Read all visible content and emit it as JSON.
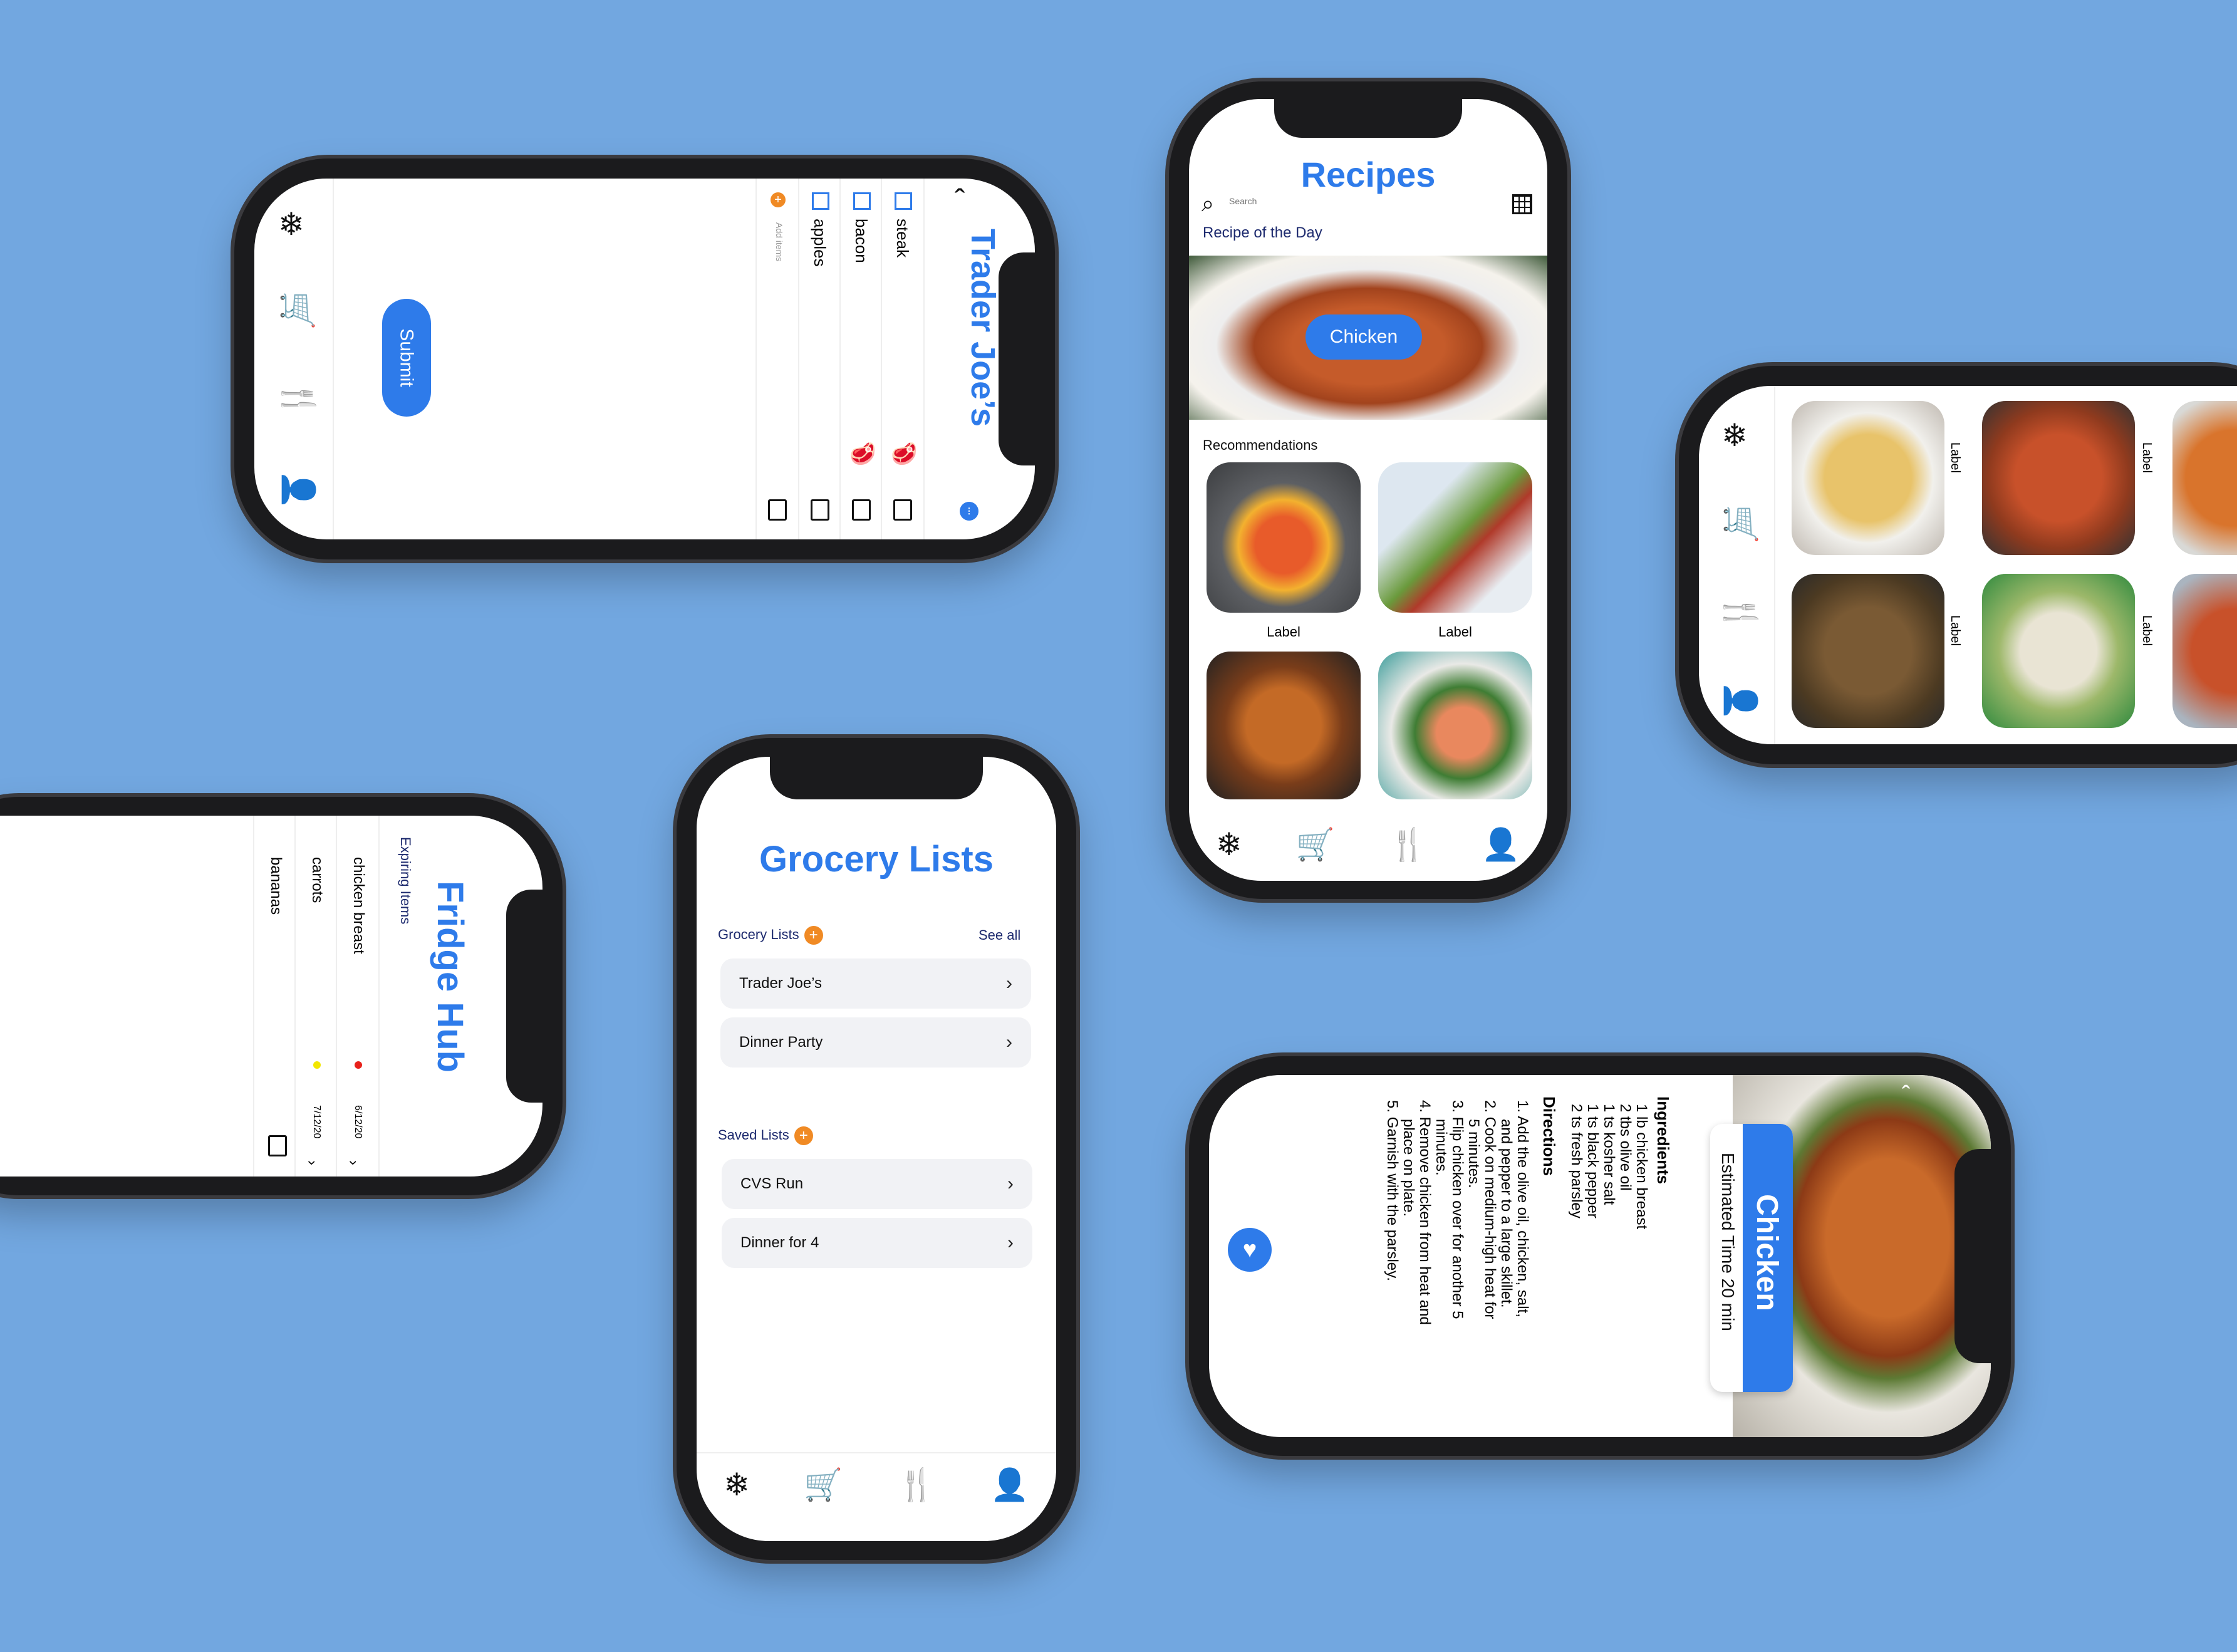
{
  "colors": {
    "background": "#72a7e0",
    "accent_blue": "#2e7bea",
    "accent_orange": "#f08a24"
  },
  "trader": {
    "title": "Trader Joe’s",
    "items": [
      "steak",
      "bacon",
      "apples"
    ],
    "add_items": "Add items",
    "submit": "Submit",
    "icons": [
      "snowflake-icon",
      "cart-icon",
      "fork-knife-icon",
      "person-icon"
    ]
  },
  "recipes": {
    "title": "Recipes",
    "search_placeholder": "Search",
    "section_day": "Recipe of the Day",
    "featured": "Chicken",
    "section_rec": "Recommendations",
    "cards": [
      "Label",
      "Label"
    ]
  },
  "gallery": {
    "labels": [
      "Label",
      "Label",
      "Label",
      "Label"
    ]
  },
  "fridge": {
    "title": "Fridge Hub",
    "section": "Expiring Items",
    "items": [
      {
        "name": "chicken breast",
        "date": "6/12/20",
        "dot": "#e8211b"
      },
      {
        "name": "carrots",
        "date": "7/12/20",
        "dot": "#f2e600"
      },
      {
        "name": "bananas",
        "date": "",
        "dot": ""
      }
    ]
  },
  "grocery": {
    "title": "Grocery Lists",
    "section_lists": "Grocery Lists",
    "see_all": "See all",
    "lists": [
      "Trader Joe’s",
      "Dinner Party"
    ],
    "section_saved": "Saved Lists",
    "saved": [
      "CVS Run",
      "Dinner for 4"
    ]
  },
  "detail": {
    "title": "Chicken",
    "time": "Estimated Time 20 min",
    "ingredients_heading": "Ingredients",
    "ingredients": [
      "1 lb chicken breast",
      "2 tbs olive oil",
      "1 ts kosher salt",
      "1 ts black pepper",
      "2 ts fresh parsley"
    ],
    "directions_heading": "Directions",
    "directions": [
      "1. Add the olive oil, chicken, salt,",
      "and pepper to a large skillet.",
      "2. Cook on medium-high heat for",
      "5 minutes.",
      "3. Flip chicken over for another 5",
      "minutes.",
      "4. Remove chicken from heat and",
      "place on plate.",
      "5. Garnish with the parsley."
    ]
  }
}
